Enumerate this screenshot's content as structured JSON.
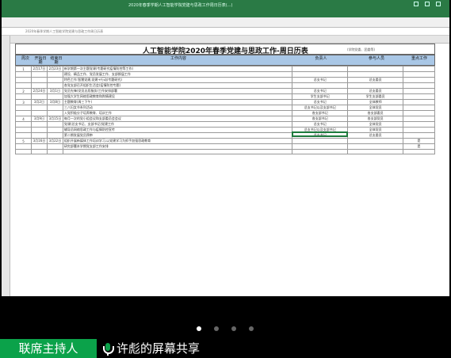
{
  "app": {
    "window_title": "2020年春季学期人工智能学院党建与思政工作周日历表(...)",
    "formula_bar": "2020年春季学期人工智能学院党建与思政工作周日历表"
  },
  "sheet": {
    "title": "人工智能学院2020年春季党建与思政工作-周日历表",
    "subtitle": "(学院党委、团委等)",
    "headers": [
      "周次",
      "开始日期",
      "结束日期",
      "工作内容",
      "负责人",
      "参与人员",
      "重点工作"
    ],
    "rows": [
      {
        "week": "1",
        "start": "2月17日",
        "end": "2月23日",
        "content": "新学期第一次主题党课(专题研究疫情防控等工作)",
        "owner": "",
        "part": "",
        "key": ""
      },
      {
        "week": "",
        "start": "",
        "end": "",
        "content": "建设、精品工作、党员发展工作、支部换届工作",
        "owner": "",
        "part": "",
        "key": ""
      },
      {
        "week": "",
        "start": "",
        "end": "",
        "content": "特色工作:智慧党建,党建+行动(专题研究)",
        "owner": "总支书记",
        "part": "总支委员",
        "key": ""
      },
      {
        "week": "",
        "start": "",
        "end": "",
        "content": "各党支部召开组织生活会(疫情防控专题)",
        "owner": "",
        "part": "",
        "key": ""
      },
      {
        "week": "2",
        "start": "2月24日",
        "end": "3月1日",
        "content": "党员先锋(党员志愿服务)工作安排部署",
        "owner": "总支书记",
        "part": "总支委员",
        "key": ""
      },
      {
        "week": "",
        "start": "",
        "end": "",
        "content": "加强大学生网络思政教育和舆情建设",
        "owner": "学生支部书记",
        "part": "学生支部委员",
        "key": ""
      },
      {
        "week": "3",
        "start": "3月2日",
        "end": "3月8日",
        "content": "主题教育(周三下午)",
        "owner": "总支书记",
        "part": "全体教师",
        "key": ""
      },
      {
        "week": "",
        "start": "",
        "end": "",
        "content": "三八妇女节系列活动",
        "owner": "总支书记以及支部书记",
        "part": "全体党员",
        "key": ""
      },
      {
        "week": "",
        "start": "",
        "end": "",
        "content": "入党积极分子培养教育、培训工作",
        "owner": "各支部书记",
        "part": "各支部委员",
        "key": ""
      },
      {
        "week": "4",
        "start": "3月9日",
        "end": "3月15日",
        "content": "每月一次的党小组会议和支部委员会会议",
        "owner": "各支部书记",
        "part": "各支部党员",
        "key": ""
      },
      {
        "week": "",
        "start": "",
        "end": "",
        "content": "党课(总支书记、支部书记)党建工作",
        "owner": "总支书记",
        "part": "全体党员",
        "key": ""
      },
      {
        "week": "",
        "start": "",
        "end": "",
        "content": "辅导员网络思政工作与疫情防控宣传",
        "owner": "总支书记以及支部书记",
        "part": "全体党员",
        "key": ""
      },
      {
        "week": "",
        "start": "",
        "end": "",
        "content": "第二期发展党员预审",
        "owner": "总支书记",
        "part": "总支委员",
        "key": ""
      },
      {
        "week": "5",
        "start": "3月16日",
        "end": "3月22日",
        "content": "组织开展新媒体工作培训学习,以党建学习为抓手加强思政教育",
        "owner": "",
        "part": "",
        "key": "是"
      },
      {
        "week": "",
        "start": "",
        "end": "",
        "content": "研究部署本学期党支部工作安排",
        "owner": "",
        "part": "",
        "key": "是"
      },
      {
        "week": "",
        "start": "",
        "end": "",
        "content": "",
        "owner": "",
        "part": "",
        "key": ""
      }
    ]
  },
  "pager": {
    "pages": 4,
    "current": 1
  },
  "footer": {
    "host_button": "联席主持人",
    "share_text": "许彪的屏幕共享",
    "mic_icon": "microphone-icon"
  },
  "colors": {
    "accent": "#0ba24a",
    "header_fill": "#a9c7e6",
    "excel_green": "#2a7a45"
  }
}
